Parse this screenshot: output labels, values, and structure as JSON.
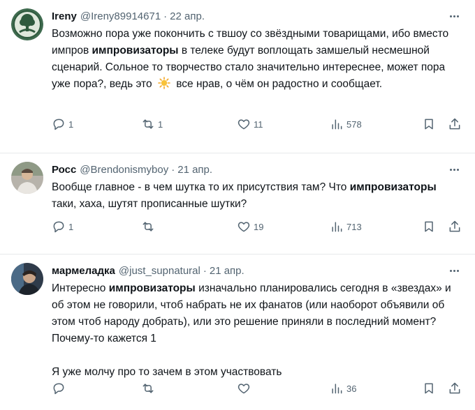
{
  "tweets": [
    {
      "name": "Ireny",
      "handle": "@Ireny89914671",
      "date": "22 апр.",
      "text": {
        "a": "Возможно пора уже покончить с твшоу со звёздными товарищами, ибо вместо импров ",
        "bold": "импровизаторы",
        "b": " в телеке будут воплощать замшелый несмешной сценарий. Сольное то творчество стало значительно интереснее, может пора уже пора?, ведь это ",
        "c": " все нрав, о чём он радостно и сообщает."
      },
      "stats": {
        "replies": "1",
        "retweets": "1",
        "likes": "11",
        "views": "578"
      },
      "avatar_icon": "tree-of-life-icon",
      "emoji_icon": "sun-emoji-icon"
    },
    {
      "name": "Росс",
      "handle": "@Brendonismyboy",
      "date": "21 апр.",
      "text": {
        "a": "Вообще главное - в чем шутка то их присутствия там? Что ",
        "bold": "импровизаторы",
        "b": " таки, хаха, шутят прописанные шутки?"
      },
      "stats": {
        "replies": "1",
        "retweets": "",
        "likes": "19",
        "views": "713"
      },
      "avatar_icon": "person-photo-icon"
    },
    {
      "name": "мармеладка",
      "handle": "@just_supnatural",
      "date": "21 апр.",
      "text": {
        "a": "Интересно ",
        "bold": "импровизаторы",
        "b": " изначально планировались сегодня в «звездах» и об этом не говорили, чтоб набрать не их фанатов (или наоборот объявили об этом чтоб народу добрать), или это решение приняли в последний момент? Почему-то кажется 1",
        "c": "Я уже молчу про то зачем в этом участвовать"
      },
      "stats": {
        "replies": "",
        "retweets": "",
        "likes": "",
        "views": "36"
      },
      "avatar_icon": "person-photo-icon"
    }
  ],
  "colors": {
    "text": "#0f1419",
    "secondary": "#536471",
    "divider": "#e7e9ea"
  }
}
